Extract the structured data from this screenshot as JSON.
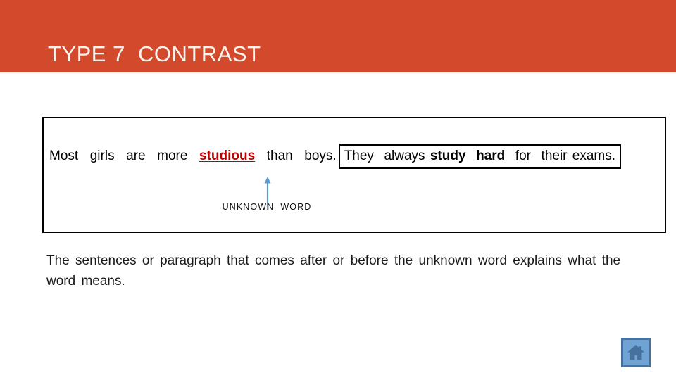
{
  "slide": {
    "title": "TYPE 7  CONTRAST",
    "header_color": "#d2492c",
    "title_color": "#fdf3ec"
  },
  "example": {
    "sentence_before": "Most  girls  are  more  ",
    "unknown_word": "studious",
    "unknown_word_color": "#c00000",
    "sentence_after": "  than  boys.",
    "clue_sentence": {
      "before": "They  always ",
      "emphasis": "study  hard",
      "after": "  for  their exams."
    },
    "arrow": {
      "name": "up-arrow",
      "color": "#5b9bd5"
    },
    "caption": "UNKNOWN  WORD"
  },
  "explanation": "The  sentences  or  paragraph  that  comes after  or  before  the  unknown  word  explains  what  the  word  means.",
  "home_button": {
    "icon": "home-icon",
    "fill_color": "#6ea3d3",
    "border_color": "#46719e",
    "glyph_color": "#46719e"
  }
}
